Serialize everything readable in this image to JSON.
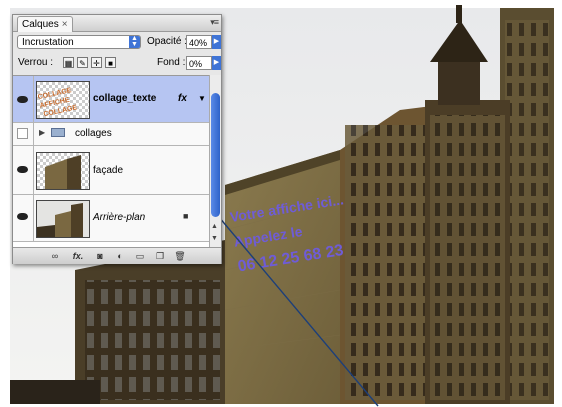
{
  "panel": {
    "tab_label": "Calques",
    "close_glyph": "×",
    "menu_glyph": "▾≡",
    "blend_mode": "Incrustation",
    "opacity_label": "Opacité :",
    "opacity_value": "40%",
    "lock_label": "Verrou :",
    "fill_label": "Fond :",
    "fill_value": "0%",
    "lock_icons": [
      "transparency-lock-icon",
      "brush-lock-icon",
      "move-lock-icon",
      "padlock-icon"
    ],
    "layers": [
      {
        "name": "collage_texte",
        "selected": true,
        "visible": true,
        "has_fx": true
      },
      {
        "name": "collages",
        "is_group": true,
        "visible": false
      },
      {
        "name": "façade",
        "visible": true
      },
      {
        "name": "Arrière-plan",
        "visible": true,
        "locked": true,
        "italic": true
      }
    ],
    "fx_label": "fx",
    "footer_icons": [
      "link-icon",
      "fx-icon",
      "mask-icon",
      "adjustment-icon",
      "group-icon",
      "new-layer-icon",
      "trash-icon"
    ],
    "footer_fx": "fx."
  },
  "photo": {
    "overlay_text": [
      "Votre affiche ici...",
      "Appelez le",
      "06 12 25 68 23"
    ],
    "overlay_color": "#6f5cd6"
  },
  "colors": {
    "panel_bg": "#e7e7e7",
    "selection": "#b6c5f2",
    "arrow": "#1c3f7a"
  }
}
